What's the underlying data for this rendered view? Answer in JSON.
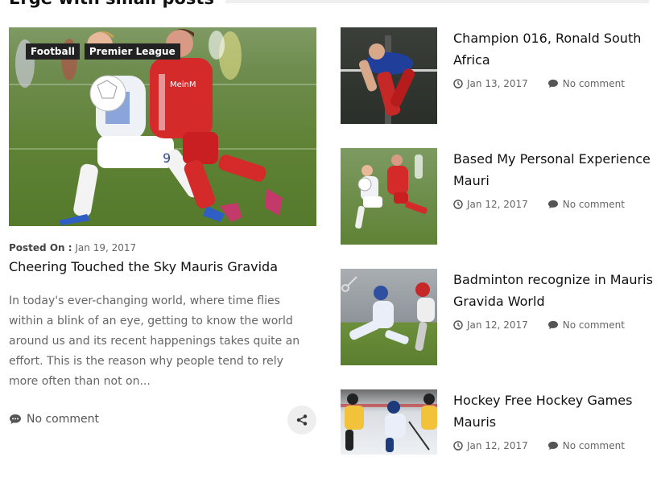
{
  "section": {
    "title": "Erge with small posts"
  },
  "lead": {
    "tags": [
      "Football",
      "Premier League"
    ],
    "posted_label": "Posted On :",
    "date": "Jan 19, 2017",
    "title": "Cheering Touched the Sky Mauris Gravida",
    "excerpt": "In today's ever-changing world, where time flies within a blink of an eye, getting to know the world around us and its recent happenings takes quite an effort. This is the reason why people tend to rely more often than not on...",
    "comment": "No comment",
    "jersey_text": "MeinM",
    "jersey_number": "9"
  },
  "posts": [
    {
      "title": "Champion 016, Ronald South Africa",
      "date": "Jan 13, 2017",
      "comment": "No comment"
    },
    {
      "title": "Based My Personal Experience Mauri",
      "date": "Jan 12, 2017",
      "comment": "No comment"
    },
    {
      "title": "Badminton recognize in Mauris Gravida World",
      "date": "Jan 12, 2017",
      "comment": "No comment"
    },
    {
      "title": "Hockey Free Hockey Games Mauris",
      "date": "Jan 12, 2017",
      "comment": "No comment"
    }
  ],
  "colors": {
    "accent": "#222222",
    "muted": "#666666",
    "share_bg": "#eeeeee"
  }
}
